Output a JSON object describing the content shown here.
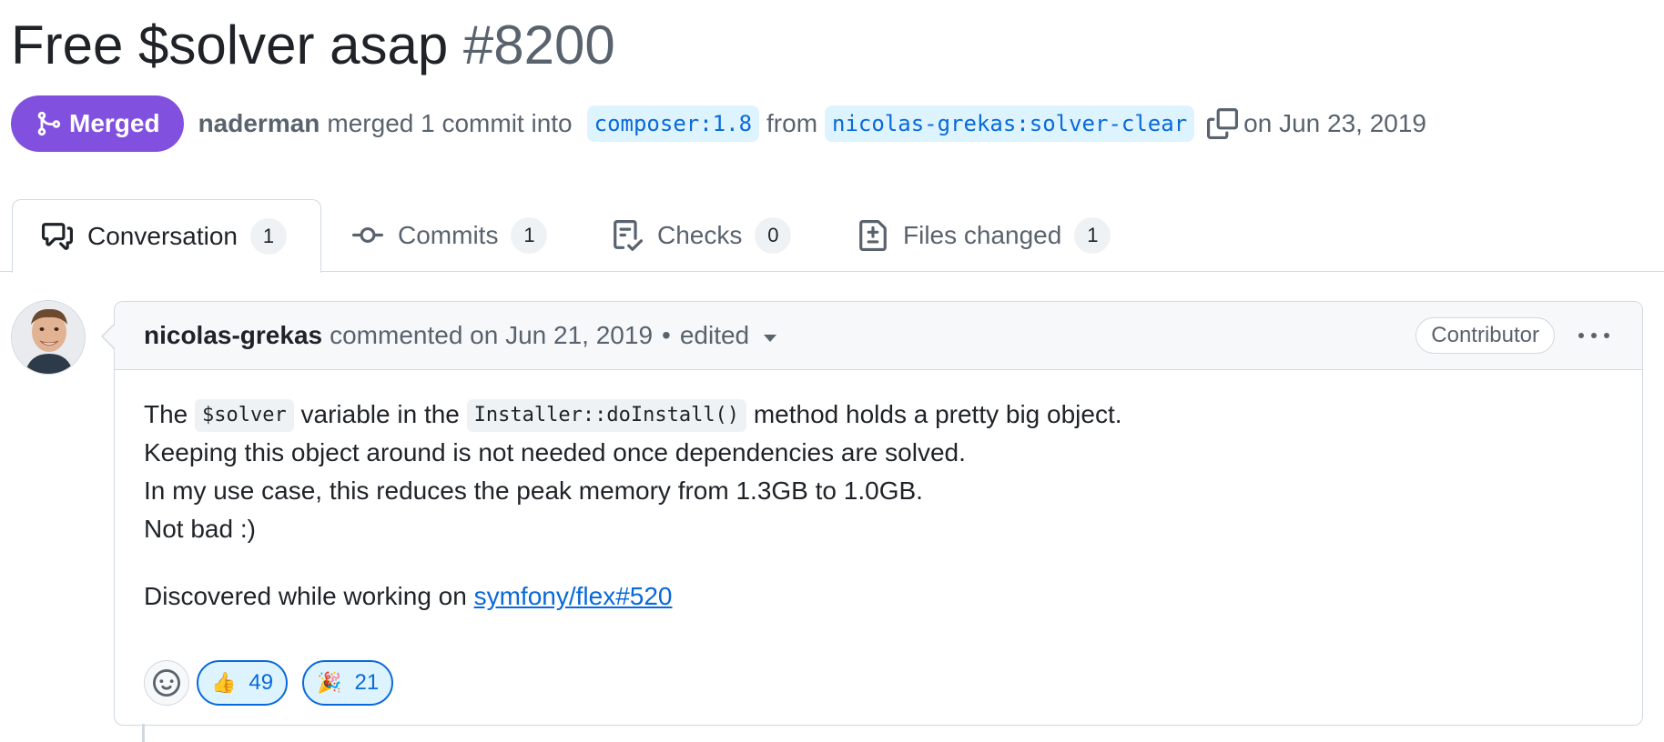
{
  "pr": {
    "title": "Free $solver asap",
    "number": "#8200",
    "state": "Merged",
    "merged_by": "naderman",
    "merged_text": "merged 1 commit into",
    "base_branch": "composer:1.8",
    "from_text": "from",
    "head_branch": "nicolas-grekas:solver-clear",
    "merged_date": "on Jun 23, 2019"
  },
  "tabs": [
    {
      "label": "Conversation",
      "count": "1",
      "icon": "comment-discussion-icon",
      "active": true
    },
    {
      "label": "Commits",
      "count": "1",
      "icon": "git-commit-icon",
      "active": false
    },
    {
      "label": "Checks",
      "count": "0",
      "icon": "checklist-icon",
      "active": false
    },
    {
      "label": "Files changed",
      "count": "1",
      "icon": "file-diff-icon",
      "active": false
    }
  ],
  "comment": {
    "author": "nicolas-grekas",
    "meta": "commented on Jun 21, 2019",
    "separator": "•",
    "edited": "edited",
    "role": "Contributor",
    "line1_a": "The",
    "line1_code1": "$solver",
    "line1_b": "variable in the",
    "line1_code2": "Installer::doInstall()",
    "line1_c": "method holds a pretty big object.",
    "line2": "Keeping this object around is not needed once dependencies are solved.",
    "line3": "In my use case, this reduces the peak memory from 1.3GB to 1.0GB.",
    "line4": "Not bad :)",
    "line5_a": "Discovered while working on",
    "line5_link": "symfony/flex#520"
  },
  "reactions": [
    {
      "emoji": "👍",
      "count": "49"
    },
    {
      "emoji": "🎉",
      "count": "21"
    }
  ],
  "colors": {
    "merged": "#8250df",
    "link": "#0969da",
    "branch_bg": "#ddf4ff"
  }
}
